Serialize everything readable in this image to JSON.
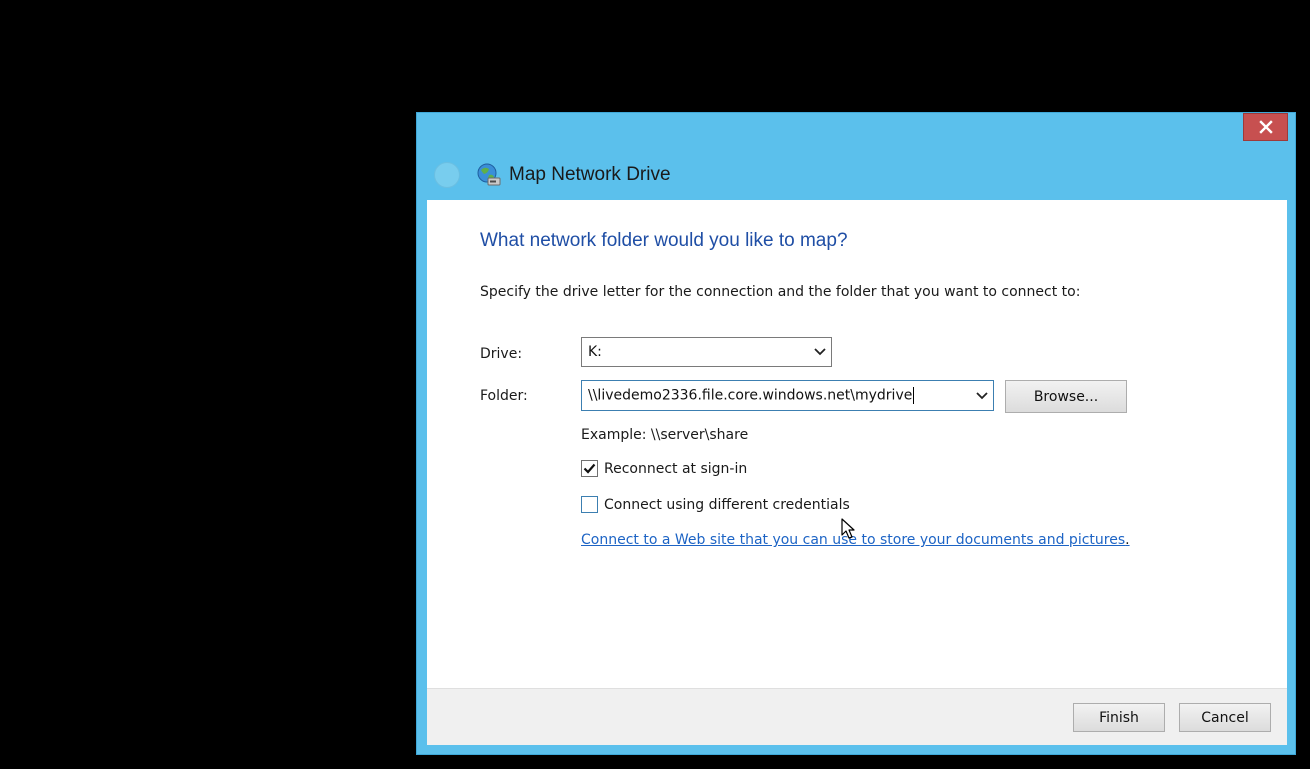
{
  "dialog": {
    "title": "Map Network Drive",
    "close_glyph": "✕",
    "title_icon": "network-drive-icon",
    "back_icon": "back-arrow-icon"
  },
  "content": {
    "heading": "What network folder would you like to map?",
    "instruction": "Specify the drive letter for the connection and the folder that you want to connect to:",
    "drive_label": "Drive:",
    "drive_value": "K:",
    "folder_label": "Folder:",
    "folder_value": "\\\\livedemo2336.file.core.windows.net\\mydrive",
    "browse_label": "Browse...",
    "example_text": "Example: \\\\server\\share",
    "reconnect_label": "Reconnect at sign-in",
    "reconnect_checked": true,
    "credentials_label": "Connect using different credentials",
    "credentials_checked": false,
    "link_text": "Connect to a Web site that you can use to store your documents and pictures",
    "link_suffix": "."
  },
  "footer": {
    "finish_label": "Finish",
    "cancel_label": "Cancel"
  },
  "colors": {
    "frame": "#5bc0ec",
    "heading": "#1f4ea5",
    "link": "#1d64c5",
    "close": "#c75050"
  }
}
